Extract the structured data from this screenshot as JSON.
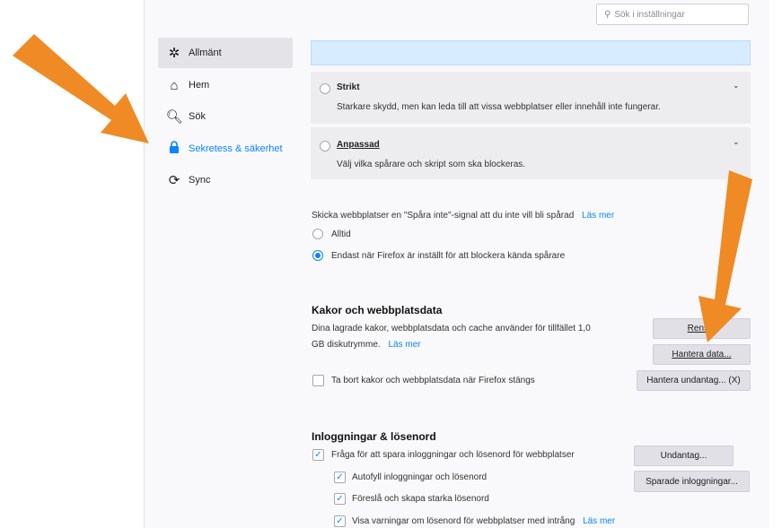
{
  "search": {
    "placeholder": "Sök i inställningar"
  },
  "sidebar": {
    "items": [
      {
        "label": "Allmänt",
        "icon": "gear-icon"
      },
      {
        "label": "Hem",
        "icon": "home-icon"
      },
      {
        "label": "Sök",
        "icon": "search-icon"
      },
      {
        "label": "Sekretess & säkerhet",
        "icon": "lock-icon"
      },
      {
        "label": "Sync",
        "icon": "sync-icon"
      }
    ]
  },
  "tracking": {
    "strict": {
      "title": "Strikt",
      "desc": "Starkare skydd, men kan leda till att vissa webbplatser eller innehåll inte fungerar."
    },
    "custom": {
      "title": "Anpassad",
      "desc": "Välj vilka spårare och skript som ska blockeras."
    }
  },
  "dnt": {
    "text": "Skicka webbplatser en \"Spåra inte\"-signal att du inte vill bli spårad",
    "learn_more": "Läs mer",
    "opt_always": "Alltid",
    "opt_only": "Endast när Firefox är inställt för att blockera kända spårare"
  },
  "cookies": {
    "heading": "Kakor och webbplatsdata",
    "desc_line1": "Dina lagrade kakor, webbplatsdata och cache använder för tillfället 1,0",
    "desc_line2": "GB diskutrymme.",
    "learn_more": "Läs mer",
    "clear_button": "Rens...",
    "manage_button": "Hantera data...",
    "exceptions_button": "Hantera undantag... (X)",
    "delete_on_close": "Ta bort kakor och webbplatsdata när Firefox stängs"
  },
  "logins": {
    "heading": "Inloggningar & lösenord",
    "ask_save": "Fråga för att spara inloggningar och lösenord för webbplatser",
    "autofill": "Autofyll inloggningar och lösenord",
    "suggest": "Föreslå och skapa starka lösenord",
    "warn": "Visa varningar om lösenord för webbplatser med intrång",
    "learn_more": "Läs mer",
    "exceptions_button": "Undantag...",
    "saved_button": "Sparade inloggningar..."
  },
  "colors": {
    "accent": "#0a84ff",
    "arrow": "#f08a24"
  }
}
